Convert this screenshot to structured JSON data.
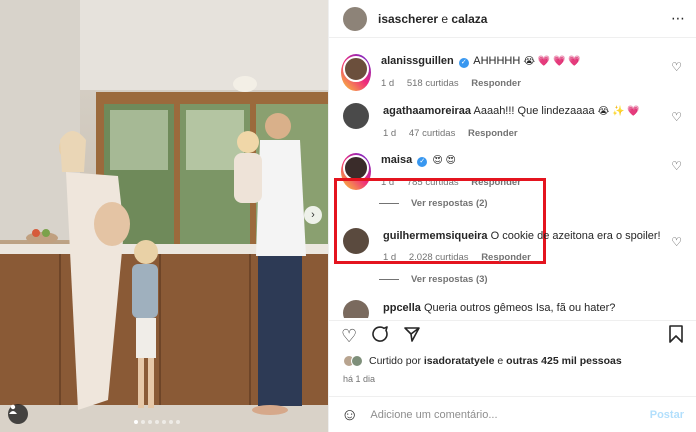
{
  "header": {
    "user1": "isascherer",
    "conj": " e ",
    "user2": "calaza",
    "more": "⋯"
  },
  "comments": [
    {
      "user": "alanissguillen",
      "text": "AHHHHH",
      "emoji": "😭 💗 💗 💗",
      "age": "1 d",
      "likes": "518 curtidas",
      "reply": "Responder"
    },
    {
      "user": "agathaamoreiraa",
      "text": "Aaaah!!! Que lindezaaaa",
      "emoji": "😭 ✨ 💗",
      "age": "1 d",
      "likes": "47 curtidas",
      "reply": "Responder"
    },
    {
      "user": "maisa",
      "text": "",
      "emoji": "😍 😍",
      "age": "1 d",
      "likes": "785 curtidas",
      "reply": "Responder",
      "view_replies": "Ver respostas (2)"
    },
    {
      "user": "guilhermemsiqueira",
      "text": "O cookie de azeitona era o spoiler!",
      "emoji": "",
      "age": "1 d",
      "likes": "2.028 curtidas",
      "reply": "Responder",
      "view_replies": "Ver respostas (3)"
    },
    {
      "user": "ppcella",
      "text": "Queria outros gêmeos Isa, fã ou hater?",
      "emoji": "",
      "age": "",
      "likes": "",
      "reply": ""
    }
  ],
  "likes": {
    "prefix": "Curtido por ",
    "user": "isadoratatyele",
    "mid": " e ",
    "others": "outras 425 mil pessoas"
  },
  "time": "há 1 dia",
  "add_comment": {
    "placeholder": "Adicione um comentário...",
    "post": "Postar"
  },
  "icons": {
    "heart": "heart-icon",
    "comment": "comment-icon",
    "share": "share-icon",
    "save": "bookmark-icon"
  },
  "colors": {
    "highlight": "#e4141f",
    "verified": "#3897f0",
    "link": "#b2dffc"
  }
}
